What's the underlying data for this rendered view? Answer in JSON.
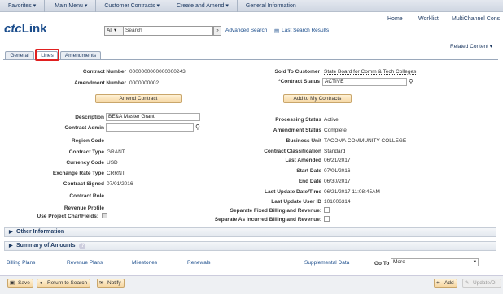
{
  "nav": {
    "favorites": "Favorites ▾",
    "main_menu": "Main Menu ▾",
    "customer_contracts": "Customer Contracts ▾",
    "create_amend": "Create and Amend ▾",
    "general_info": "General Information"
  },
  "header": {
    "logo_prefix": "ctc",
    "logo_main": "Link",
    "home": "Home",
    "worklist": "Worklist",
    "multichannel": "MultiChannel Cons"
  },
  "search": {
    "scope": "All",
    "placeholder": "Search",
    "advanced": "Advanced Search",
    "last_results": "Last Search Results"
  },
  "related_content": "Related Content ▾",
  "tabs": [
    "General",
    "Lines",
    "Amendments"
  ],
  "contract": {
    "contract_number_label": "Contract Number",
    "contract_number": "0000000000000000243",
    "amendment_number_label": "Amendment Number",
    "amendment_number": "0000000002",
    "sold_to_label": "Sold To Customer",
    "sold_to": "State Board for Comm & Tech Colleges",
    "status_label": "*Contract Status",
    "status": "ACTIVE",
    "amend_btn": "Amend Contract",
    "add_btn": "Add to My Contracts",
    "description_label": "Description",
    "description": "BE&A Master Grant",
    "admin_label": "Contract Admin",
    "region_label": "Region Code",
    "type_label": "Contract Type",
    "type": "GRANT",
    "currency_label": "Currency Code",
    "currency": "USD",
    "rate_label": "Exchange Rate Type",
    "rate": "CRRNT",
    "signed_label": "Contract Signed",
    "signed": "07/01/2016",
    "role_label": "Contract Role",
    "revenue_profile_label": "Revenue Profile",
    "chartfields_label": "Use Project ChartFields:",
    "proc_status_label": "Processing Status",
    "proc_status": "Active",
    "amend_status_label": "Amendment Status",
    "amend_status": "Complete",
    "bu_label": "Business Unit",
    "bu": "TACOMA COMMUNITY COLLEGE",
    "class_label": "Contract Classification",
    "class": "Standard",
    "last_amended_label": "Last Amended",
    "last_amended": "06/21/2017",
    "start_label": "Start Date",
    "start": "07/01/2016",
    "end_label": "End Date",
    "end": "06/30/2017",
    "upd_dt_label": "Last Update Date/Time",
    "upd_dt": "06/21/2017 11:08:45AM",
    "upd_user_label": "Last Update User ID",
    "upd_user": "101006314",
    "sep_fixed_label": "Separate Fixed Billing and Revenue:",
    "sep_incurred_label": "Separate As Incurred Billing and Revenue:"
  },
  "sections": {
    "other": "Other Information",
    "summary": "Summary of Amounts"
  },
  "bottom_links": {
    "billing": "Billing Plans",
    "revenue": "Revenue Plans",
    "milestones": "Milestones",
    "renewals": "Renewals",
    "supplemental": "Supplemental Data",
    "goto_label": "Go To",
    "goto_value": "More"
  },
  "toolbar": {
    "save": "Save",
    "return": "Return to Search",
    "notify": "Notify",
    "add": "Add",
    "update": "Update/Di"
  }
}
